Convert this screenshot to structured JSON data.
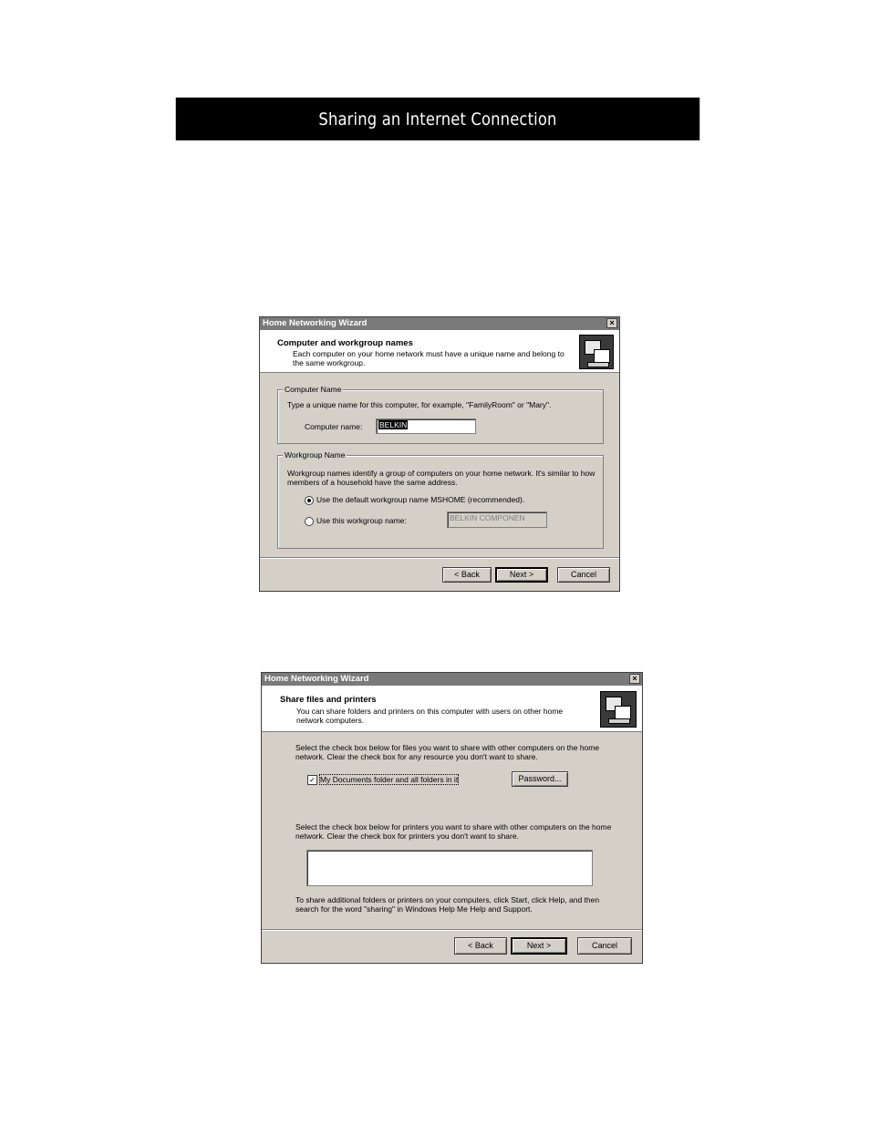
{
  "banner": {
    "title": "Sharing an Internet Connection"
  },
  "dialog1": {
    "window_title": "Home Networking Wizard",
    "close_glyph": "×",
    "header_title": "Computer and workgroup names",
    "header_subtitle": "Each computer on your home network must have a unique name and belong to the same workgroup.",
    "computer_group": {
      "legend": "Computer Name",
      "instruction": "Type a unique name for this computer, for example, \"FamilyRoom\" or \"Mary\".",
      "label": "Computer name:",
      "value": "BELKIN"
    },
    "workgroup_group": {
      "legend": "Workgroup Name",
      "description": "Workgroup names identify a group of computers on your home network. It's similar to how members of a household have the same address.",
      "option_default": "Use the default workgroup name MSHOME (recommended).",
      "option_custom": "Use this workgroup name:",
      "custom_value": "BELKIN COMPONEN"
    },
    "buttons": {
      "back": "< Back",
      "next": "Next >",
      "cancel": "Cancel"
    }
  },
  "dialog2": {
    "window_title": "Home Networking Wizard",
    "close_glyph": "×",
    "header_title": "Share files and printers",
    "header_subtitle": "You can share folders and printers on this computer with users on other home network computers.",
    "files_instruction": "Select the check box below for files you want to share with other computers on the home network. Clear the check box for any resource you don't want to share.",
    "checkbox_label": "My Documents folder and all folders in it",
    "checkbox_checked": true,
    "check_glyph": "✓",
    "password_button": "Password...",
    "printers_instruction": "Select the check box below for printers you want to share with other computers on the home network. Clear the check box for printers you don't want to share.",
    "footer_note": "To share additional folders or printers on your computers, click Start, click Help, and then search for the word \"sharing\" in Windows Help Me Help and Support.",
    "buttons": {
      "back": "< Back",
      "next": "Next >",
      "cancel": "Cancel"
    }
  }
}
